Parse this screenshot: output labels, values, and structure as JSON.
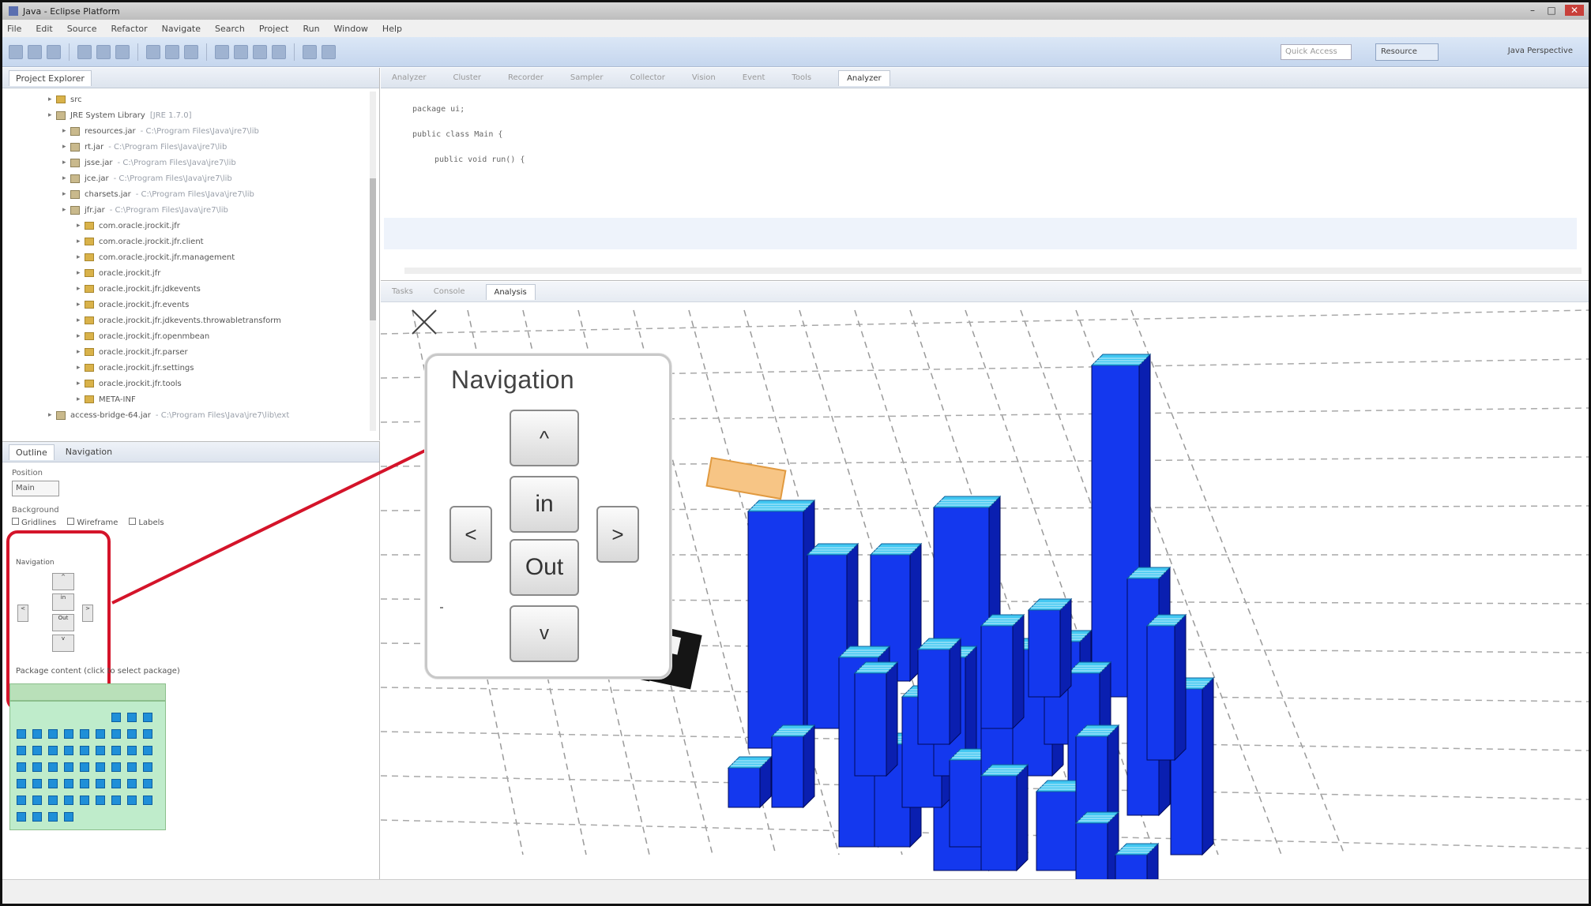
{
  "window": {
    "title": "Java - Eclipse Platform"
  },
  "menu": [
    "File",
    "Edit",
    "Source",
    "Refactor",
    "Navigate",
    "Search",
    "Project",
    "Run",
    "Window",
    "Help"
  ],
  "toolbar": {
    "quick_access": "Quick Access",
    "perspective_active": "Resource",
    "perspective_other": "Java Perspective"
  },
  "project_explorer": {
    "tab_label": "Project Explorer",
    "items": [
      {
        "label": "src",
        "path": "",
        "icon": "folder"
      },
      {
        "label": "JRE System Library",
        "path": "[JRE 1.7.0]",
        "icon": "jar"
      },
      {
        "label": "resources.jar",
        "path": "- C:\\Program Files\\Java\\jre7\\lib",
        "icon": "jar"
      },
      {
        "label": "rt.jar",
        "path": "- C:\\Program Files\\Java\\jre7\\lib",
        "icon": "jar"
      },
      {
        "label": "jsse.jar",
        "path": "- C:\\Program Files\\Java\\jre7\\lib",
        "icon": "jar"
      },
      {
        "label": "jce.jar",
        "path": "- C:\\Program Files\\Java\\jre7\\lib",
        "icon": "jar"
      },
      {
        "label": "charsets.jar",
        "path": "- C:\\Program Files\\Java\\jre7\\lib",
        "icon": "jar"
      },
      {
        "label": "jfr.jar",
        "path": "- C:\\Program Files\\Java\\jre7\\lib",
        "icon": "jar"
      },
      {
        "label": "com.oracle.jrockit.jfr",
        "path": "",
        "icon": "folder"
      },
      {
        "label": "com.oracle.jrockit.jfr.client",
        "path": "",
        "icon": "folder"
      },
      {
        "label": "com.oracle.jrockit.jfr.management",
        "path": "",
        "icon": "folder"
      },
      {
        "label": "oracle.jrockit.jfr",
        "path": "",
        "icon": "folder"
      },
      {
        "label": "oracle.jrockit.jfr.jdkevents",
        "path": "",
        "icon": "folder"
      },
      {
        "label": "oracle.jrockit.jfr.events",
        "path": "",
        "icon": "folder"
      },
      {
        "label": "oracle.jrockit.jfr.jdkevents.throwabletransform",
        "path": "",
        "icon": "folder"
      },
      {
        "label": "oracle.jrockit.jfr.openmbean",
        "path": "",
        "icon": "folder"
      },
      {
        "label": "oracle.jrockit.jfr.parser",
        "path": "",
        "icon": "folder"
      },
      {
        "label": "oracle.jrockit.jfr.settings",
        "path": "",
        "icon": "folder"
      },
      {
        "label": "oracle.jrockit.jfr.tools",
        "path": "",
        "icon": "folder"
      },
      {
        "label": "META-INF",
        "path": "",
        "icon": "folder"
      },
      {
        "label": "access-bridge-64.jar",
        "path": "- C:\\Program Files\\Java\\jre7\\lib\\ext",
        "icon": "jar"
      }
    ]
  },
  "lower_left": {
    "tabs": [
      "Outline",
      "Navigation"
    ],
    "position_label": "Position",
    "position_value": "Main",
    "background_label": "Background",
    "options": [
      "Gridlines",
      "Wireframe",
      "Labels"
    ],
    "mini_nav_title": "Navigation",
    "mini_nav_buttons": {
      "up": "^",
      "in": "in",
      "out": "Out",
      "down": "v",
      "left": "<",
      "right": ">"
    },
    "package_label": "Package content (click to select package)"
  },
  "editor": {
    "tabs": [
      "Analyzer",
      "Cluster",
      "Recorder",
      "Sampler",
      "Collector",
      "Vision",
      "Event",
      "Tools",
      "Analyzer"
    ],
    "code": [
      "package ui;",
      "public class Main {",
      "public void run() {"
    ]
  },
  "visualization": {
    "tabs": [
      "Tasks",
      "Console",
      "Analysis"
    ],
    "active_tab": "Analysis"
  },
  "navigation_popup": {
    "title": "Navigation",
    "up": "^",
    "in": "in",
    "out": "Out",
    "down": "v",
    "left": "<",
    "right": ">"
  },
  "colors": {
    "bar_front": "#1438ee",
    "bar_side": "#0a1fb0",
    "bar_top": "#43c8f2",
    "highlight": "#d4142a",
    "grid_cell": "#1f8fd8",
    "grid_bg": "#bfeccb"
  }
}
